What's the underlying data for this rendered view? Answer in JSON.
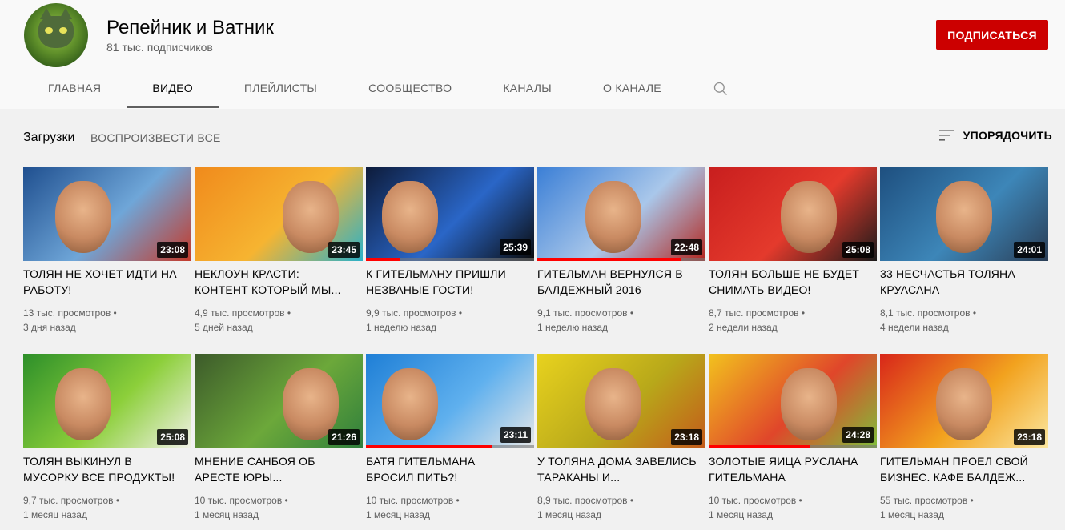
{
  "channel": {
    "name": "Репейник и Ватник",
    "subscribers": "81 тыс. подписчиков",
    "subscribe_label": "ПОДПИСАТЬСЯ"
  },
  "tabs": [
    {
      "label": "ГЛАВНАЯ",
      "active": false
    },
    {
      "label": "ВИДЕО",
      "active": true
    },
    {
      "label": "ПЛЕЙЛИСТЫ",
      "active": false
    },
    {
      "label": "СООБЩЕСТВО",
      "active": false
    },
    {
      "label": "КАНАЛЫ",
      "active": false
    },
    {
      "label": "О КАНАЛЕ",
      "active": false
    }
  ],
  "subbar": {
    "uploads": "Загрузки",
    "play_all": "ВОСПРОИЗВЕСТИ ВСЕ",
    "sort": "УПОРЯДОЧИТЬ"
  },
  "videos": [
    {
      "title": "ТОЛЯН НЕ ХОЧЕТ ИДТИ НА РАБОТУ!",
      "views": "13 тыс. просмотров",
      "date": "3 дня назад",
      "duration": "23:08",
      "progress": 0,
      "colors": [
        "#1f4f8f",
        "#6fa6d8",
        "#c53a2a"
      ]
    },
    {
      "title": "НЕКЛОУН КРАСТИ: КОНТЕНТ КОТОРЫЙ МЫ...",
      "views": "4,9 тыс. просмотров",
      "date": "5 дней назад",
      "duration": "23:45",
      "progress": 0,
      "colors": [
        "#f08a1c",
        "#f6b431",
        "#2ab1c9"
      ]
    },
    {
      "title": "К ГИТЕЛЬМАНУ ПРИШЛИ НЕЗВАНЫЕ ГОСТИ!",
      "views": "9,9 тыс. просмотров",
      "date": "1 неделю назад",
      "duration": "25:39",
      "progress": 0.2,
      "colors": [
        "#0d1b3a",
        "#2a66c7",
        "#0a0a0a"
      ]
    },
    {
      "title": "ГИТЕЛЬМАН ВЕРНУЛСЯ В БАЛДЕЖНЫЙ 2016",
      "views": "9,1 тыс. просмотров",
      "date": "1 неделю назад",
      "duration": "22:48",
      "progress": 0.85,
      "colors": [
        "#3b7fd6",
        "#a9c7ea",
        "#b3261e"
      ]
    },
    {
      "title": "ТОЛЯН БОЛЬШЕ НЕ БУДЕТ СНИМАТЬ ВИДЕО!",
      "views": "8,7 тыс. просмотров",
      "date": "2 недели назад",
      "duration": "25:08",
      "progress": 0,
      "colors": [
        "#c81e1e",
        "#e43a2c",
        "#1a1a1a"
      ]
    },
    {
      "title": "33 НЕСЧАСТЬЯ ТОЛЯНА КРУАСАНА",
      "views": "8,1 тыс. просмотров",
      "date": "4 недели назад",
      "duration": "24:01",
      "progress": 0,
      "colors": [
        "#1e4f7f",
        "#3d86b8",
        "#2a3d55"
      ]
    },
    {
      "title": "ТОЛЯН ВЫКИНУЛ В МУСОРКУ ВСЕ ПРОДУКТЫ!",
      "views": "9,7 тыс. просмотров",
      "date": "1 месяц назад",
      "duration": "25:08",
      "progress": 0,
      "colors": [
        "#2d8f2a",
        "#8ccf3a",
        "#f2f2e8"
      ]
    },
    {
      "title": "МНЕНИЕ САНБОЯ ОБ АРЕСТЕ ЮРЫ...",
      "views": "10 тыс. просмотров",
      "date": "1 месяц назад",
      "duration": "21:26",
      "progress": 0,
      "colors": [
        "#3c5a2a",
        "#6ca83a",
        "#2f7f3c"
      ]
    },
    {
      "title": "БАТЯ ГИТЕЛЬМАНА БРОСИЛ ПИТЬ?!",
      "views": "10 тыс. просмотров",
      "date": "1 месяц назад",
      "duration": "23:11",
      "progress": 0.75,
      "colors": [
        "#1f7fd6",
        "#5fb0ee",
        "#e8e8e8"
      ]
    },
    {
      "title": "У ТОЛЯНА ДОМА ЗАВЕЛИСЬ ТАРАКАНЫ И...",
      "views": "8,9 тыс. просмотров",
      "date": "1 месяц назад",
      "duration": "23:18",
      "progress": 0,
      "colors": [
        "#e8d21e",
        "#b8a81a",
        "#c45a1a"
      ]
    },
    {
      "title": "ЗОЛОТЫЕ ЯИЦА РУСЛАНА ГИТЕЛЬМАНА",
      "views": "10 тыс. просмотров",
      "date": "1 месяц назад",
      "duration": "24:28",
      "progress": 0.6,
      "colors": [
        "#f2c21e",
        "#e0462a",
        "#7fbf3a"
      ]
    },
    {
      "title": "ГИТЕЛЬМАН ПРОЕЛ СВОЙ БИЗНЕС. КАФЕ БАЛДЕЖ...",
      "views": "55 тыс. просмотров",
      "date": "1 месяц назад",
      "duration": "23:18",
      "progress": 0,
      "colors": [
        "#d8261a",
        "#f2a21e",
        "#fbe7a0"
      ]
    }
  ],
  "icons": {
    "search": "search-icon",
    "sort": "sort-icon"
  },
  "brand_color": "#cc0000"
}
